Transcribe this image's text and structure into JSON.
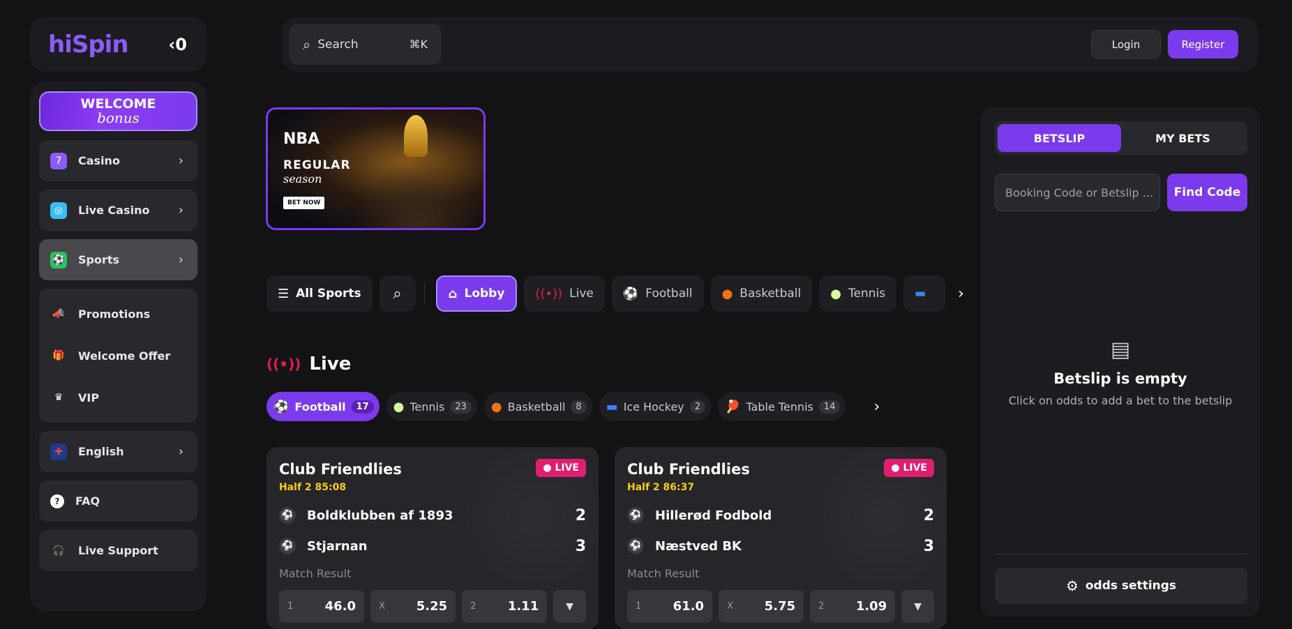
{
  "brand": {
    "logo": "hiSpin",
    "collapse": "‹0"
  },
  "sidebar": {
    "welcome": {
      "line1": "WELCOME",
      "line2": "bonus"
    },
    "items": [
      {
        "label": "Casino",
        "icon": "slot-seven-icon",
        "color": "#8b5cf6"
      },
      {
        "label": "Live Casino",
        "icon": "roulette-icon",
        "color": "#38bdf8"
      },
      {
        "label": "Sports",
        "icon": "soccer-ball-icon",
        "color": "#22c55e"
      }
    ],
    "group": [
      {
        "label": "Promotions",
        "icon": "megaphone-icon"
      },
      {
        "label": "Welcome Offer",
        "icon": "gift-icon"
      },
      {
        "label": "VIP",
        "icon": "crown-icon"
      }
    ],
    "language": "English",
    "faq": "FAQ",
    "support": "Live Support"
  },
  "topbar": {
    "search_label": "Search",
    "shortcut": "⌘K",
    "login": "Login",
    "register": "Register"
  },
  "banner": {
    "nba": "NBA",
    "regular": "REGULAR",
    "season": "season",
    "cta": "BET NOW"
  },
  "sportbar": {
    "all_sports": "All Sports",
    "pills": [
      {
        "label": "Lobby",
        "icon": "home-icon"
      },
      {
        "label": "Live",
        "icon": "live-signal-icon"
      },
      {
        "label": "Football",
        "icon": "soccer-ball-icon"
      },
      {
        "label": "Basketball",
        "icon": "basketball-icon"
      },
      {
        "label": "Tennis",
        "icon": "tennis-ball-icon"
      }
    ]
  },
  "live": {
    "title": "Live",
    "tabs": [
      {
        "label": "Football",
        "count": "17"
      },
      {
        "label": "Tennis",
        "count": "23"
      },
      {
        "label": "Basketball",
        "count": "8"
      },
      {
        "label": "Ice Hockey",
        "count": "2"
      },
      {
        "label": "Table Tennis",
        "count": "14"
      }
    ],
    "matches": [
      {
        "league": "Club Friendlies",
        "time": "Half 2 85:08",
        "badge": "LIVE",
        "home": "Boldklubben af 1893",
        "home_score": "2",
        "away": "Stjarnan",
        "away_score": "3",
        "market": "Match Result",
        "odds": [
          {
            "label": "1",
            "value": "46.0"
          },
          {
            "label": "X",
            "value": "5.25"
          },
          {
            "label": "2",
            "value": "1.11"
          }
        ]
      },
      {
        "league": "Club Friendlies",
        "time": "Half 2 86:37",
        "badge": "LIVE",
        "home": "Hillerød Fodbold",
        "home_score": "2",
        "away": "Næstved BK",
        "away_score": "3",
        "market": "Match Result",
        "odds": [
          {
            "label": "1",
            "value": "61.0"
          },
          {
            "label": "X",
            "value": "5.75"
          },
          {
            "label": "2",
            "value": "1.09"
          }
        ]
      }
    ]
  },
  "betslip": {
    "tab_betslip": "BETSLIP",
    "tab_mybets": "MY BETS",
    "input_placeholder": "Booking Code or Betslip ...",
    "find": "Find Code",
    "empty_title": "Betslip is empty",
    "empty_sub": "Click on odds to add a bet to the betslip",
    "settings": "odds settings"
  },
  "colors": {
    "accent": "#7c3aed",
    "live": "#e11d72",
    "time": "#facc15"
  }
}
